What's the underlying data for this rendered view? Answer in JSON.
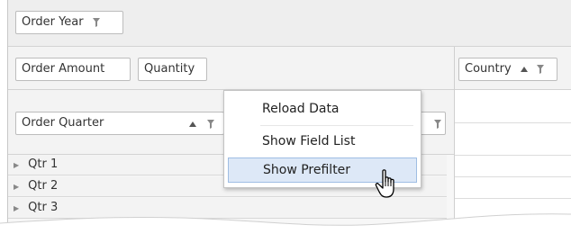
{
  "filter_area": {
    "fields": [
      {
        "label": "Order Year"
      }
    ]
  },
  "data_area": {
    "fields": [
      {
        "label": "Order Amount"
      },
      {
        "label": "Quantity"
      }
    ]
  },
  "column_area": {
    "fields": [
      {
        "label": "Country"
      }
    ]
  },
  "row_area": {
    "fields": [
      {
        "label": "Order Quarter"
      }
    ]
  },
  "rows": [
    {
      "label": "Qtr 1"
    },
    {
      "label": "Qtr 2"
    },
    {
      "label": "Qtr 3"
    }
  ],
  "context_menu": {
    "items": [
      {
        "label": "Reload Data"
      },
      {
        "label": "Show Field List"
      },
      {
        "label": "Show Prefilter"
      }
    ],
    "highlighted_index": 2
  },
  "colors": {
    "highlight_bg": "#dde8f7",
    "highlight_border": "#9fbde3"
  }
}
